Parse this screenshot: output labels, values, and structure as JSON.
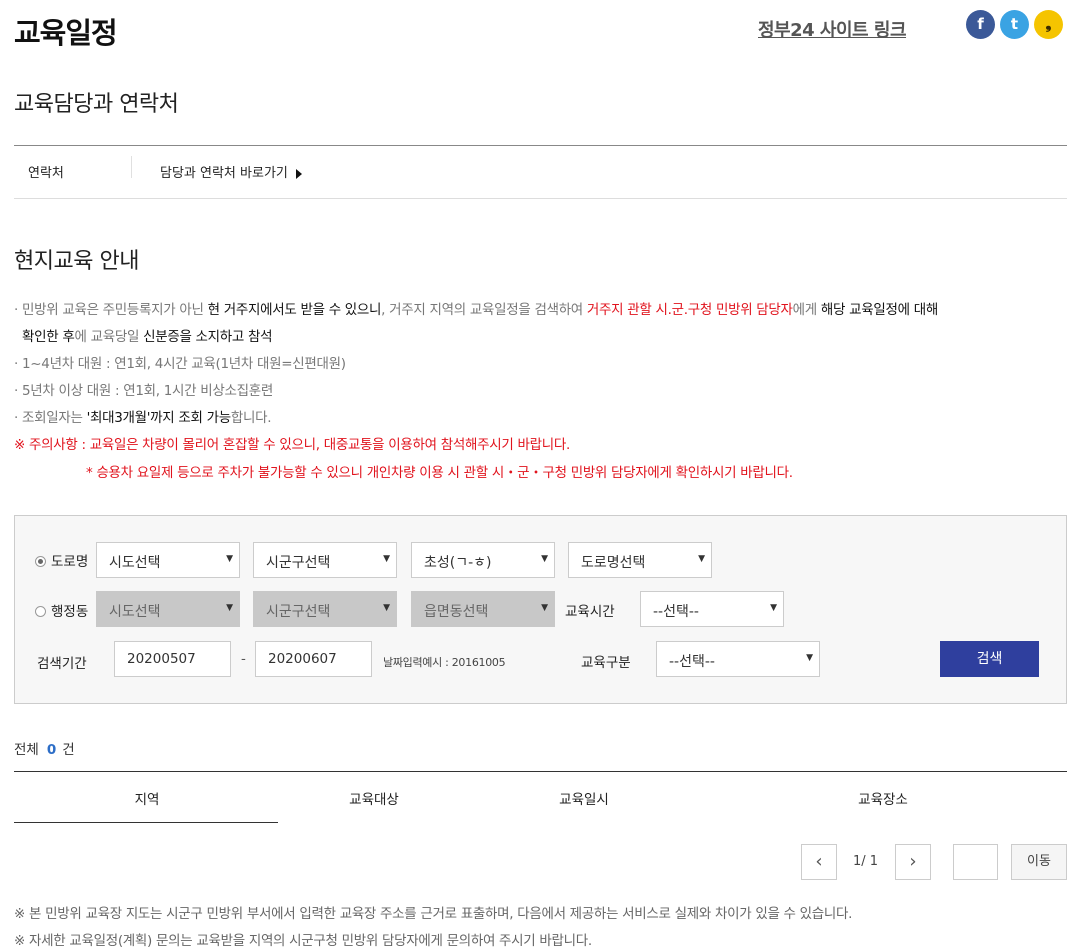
{
  "header": {
    "title": "교육일정",
    "gov_link": "정부24 사이트 링크",
    "sns": {
      "facebook": "f",
      "twitter": "t",
      "kakao": "❟"
    }
  },
  "contact": {
    "heading": "교육담당과 연락처",
    "label": "연락처",
    "link": "담당과 연락처 바로가기"
  },
  "onsite": {
    "heading": "현지교육 안내",
    "line1": {
      "a": "· 민방위 교육은 주민등록지가 아닌 ",
      "b": "현 거주지에서도 받을 수 있으니",
      "c": ", 거주지 지역의 교육일정을 검색하여 ",
      "d": "거주지 관할 시.군.구청 민방위 담당자",
      "e": "에게 ",
      "f": "해당 교육일정에 대해"
    },
    "line2": {
      "a": "확인한 후",
      "b": "에 교육당일 ",
      "c": "신분증을 소지하고 참석"
    },
    "line3": "· 1~4년차 대원 : 연1회, 4시간 교육(1년차 대원=신편대원)",
    "line4": "· 5년차 이상 대원 : 연1회, 1시간 비상소집훈련",
    "line5": {
      "a": "· 조회일자는 ",
      "b": "'최대3개월'까지 조회 가능",
      "c": "합니다."
    },
    "warn1": "※ 주의사항 : 교육일은 차량이 몰리어 혼잡할 수 있으니, 대중교통을 이용하여 참석해주시기 바랍니다.",
    "warn2": "* 승용차 요일제 등으로 주차가 불가능할 수 있으니 개인차량 이용 시 관할 시・군・구청 민방위 담당자에게 확인하시기 바랍니다."
  },
  "search": {
    "road_label": "도로명",
    "road_selects": [
      "시도선택",
      "시군구선택",
      "초성(ㄱ-ㅎ)",
      "도로명선택"
    ],
    "admin_label": "행정동",
    "admin_selects": [
      "시도선택",
      "시군구선택",
      "읍면동선택"
    ],
    "time_label": "교육시간",
    "time_value": "--선택--",
    "period_label": "검색기간",
    "date_from": "20200507",
    "date_sep": "-",
    "date_to": "20200607",
    "date_hint": "날짜입력예시 : 20161005",
    "type_label": "교육구분",
    "type_value": "--선택--",
    "search_button": "검색"
  },
  "results": {
    "total_prefix": "전체",
    "total_count": "0",
    "total_suffix": "건",
    "columns": [
      "지역",
      "교육대상",
      "교육일시",
      "교육장소"
    ]
  },
  "pager": {
    "prev": "‹",
    "page_info": "1/ 1",
    "next": "›",
    "move_button": "이동"
  },
  "footer": {
    "note1": "※ 본 민방위 교육장 지도는 시군구 민방위 부서에서 입력한 교육장 주소를 근거로 표출하며, 다음에서 제공하는 서비스로 실제와 차이가 있을 수 있습니다.",
    "note2": "※ 자세한 교육일정(계획) 문의는 교육받을 지역의 시군구청 민방위 담당자에게 문의하여 주시기 바랍니다."
  },
  "colors": {
    "accent_red": "#e1131d",
    "search_button": "#2f3f9e",
    "count_blue": "#2d6ec7"
  }
}
